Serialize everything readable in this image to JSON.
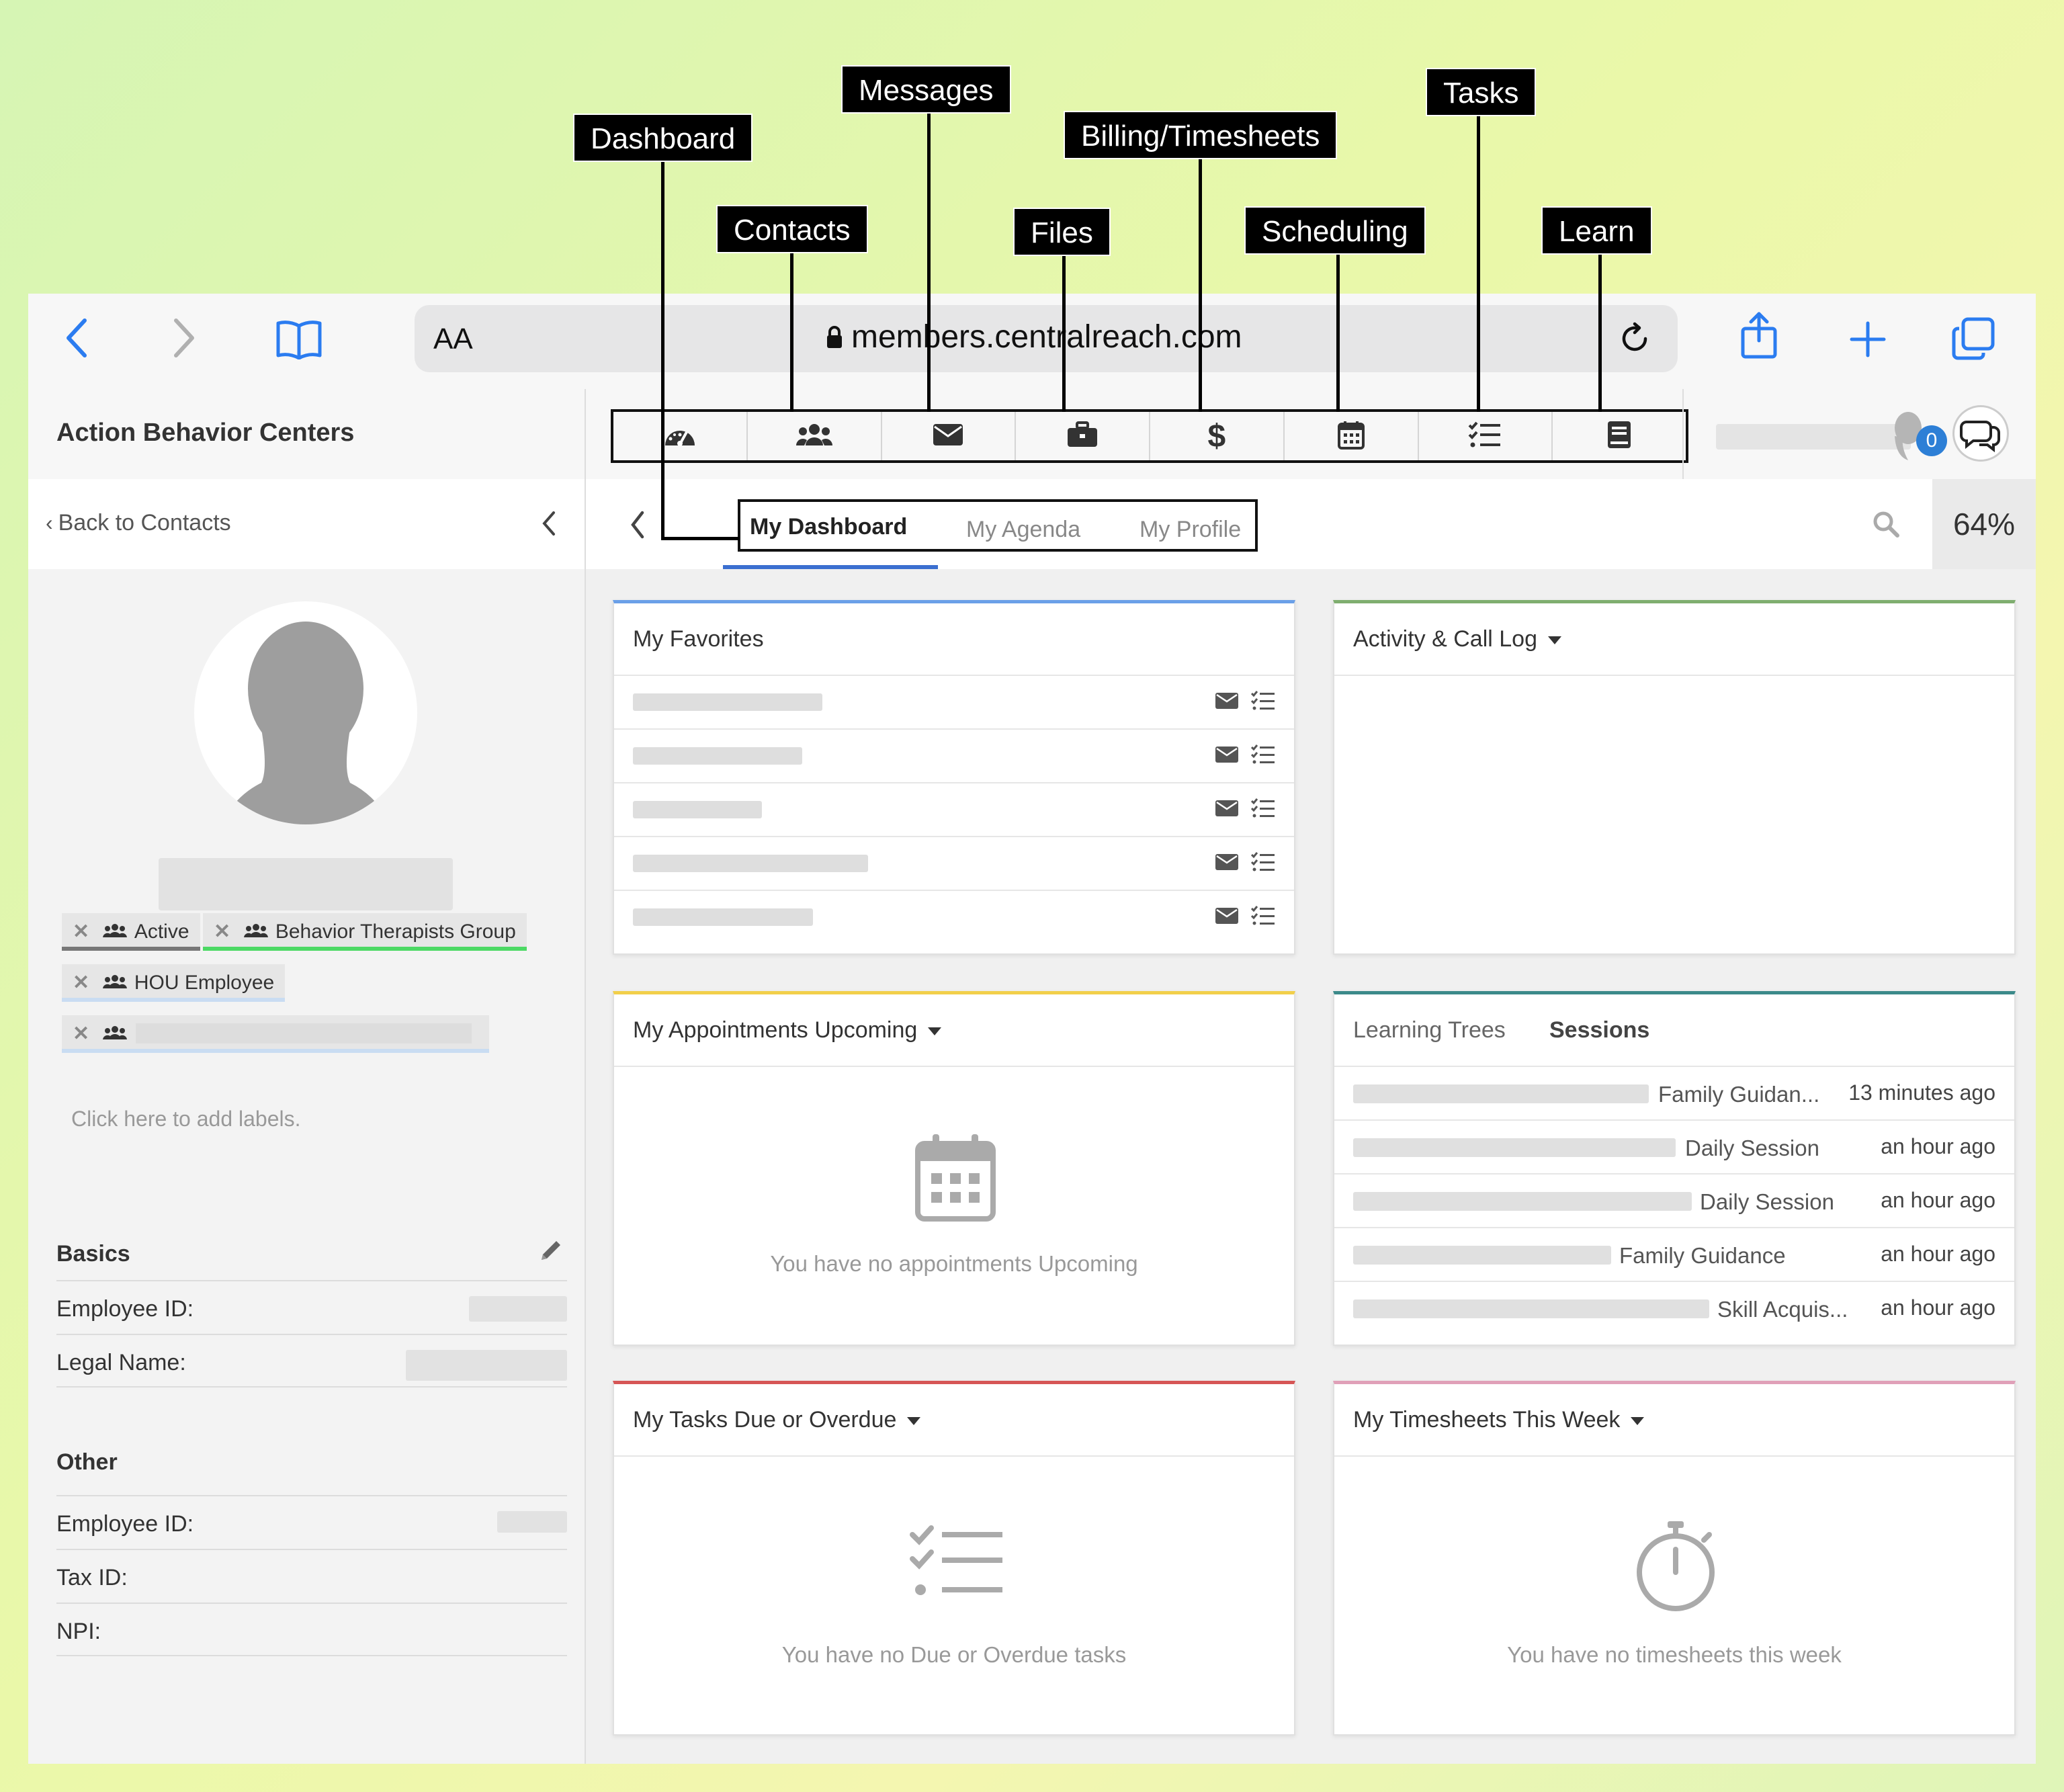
{
  "callouts": {
    "dashboard": "Dashboard",
    "contacts": "Contacts",
    "messages": "Messages",
    "files": "Files",
    "billing": "Billing/Timesheets",
    "scheduling": "Scheduling",
    "tasks": "Tasks",
    "learn": "Learn"
  },
  "browser": {
    "text_size_label": "AA",
    "url": "members.centralreach.com"
  },
  "header": {
    "org_name": "Action Behavior Centers",
    "nav_icons": [
      "dashboard-icon",
      "contacts-icon",
      "messages-icon",
      "files-icon",
      "billing-icon",
      "scheduling-icon",
      "tasks-icon",
      "learn-icon"
    ],
    "notification_count": "0"
  },
  "subheader": {
    "back_label": "Back to Contacts",
    "tabs": [
      "My Dashboard",
      "My Agenda",
      "My Profile"
    ],
    "active_tab": "My Dashboard",
    "zoom": "64%"
  },
  "sidebar": {
    "labels": [
      "Active",
      "Behavior Therapists Group",
      "HOU Employee"
    ],
    "add_labels": "Click here to add labels.",
    "basics": {
      "title": "Basics",
      "fields": [
        "Employee ID:",
        "Legal Name:"
      ]
    },
    "other": {
      "title": "Other",
      "fields": [
        "Employee ID:",
        "Tax ID:",
        "NPI:"
      ]
    }
  },
  "widgets": {
    "favorites": {
      "title": "My Favorites"
    },
    "activity": {
      "title": "Activity & Call Log"
    },
    "appointments": {
      "title": "My Appointments Upcoming",
      "empty": "You have no appointments Upcoming"
    },
    "sessions": {
      "tabs": [
        "Learning Trees",
        "Sessions"
      ],
      "rows": [
        {
          "type": "Family Guidan...",
          "time": "13 minutes ago"
        },
        {
          "type": "Daily Session",
          "time": "an hour ago"
        },
        {
          "type": "Daily Session",
          "time": "an hour ago"
        },
        {
          "type": "Family Guidance",
          "time": "an hour ago"
        },
        {
          "type": "Skill Acquis...",
          "time": "an hour ago"
        }
      ]
    },
    "tasks": {
      "title": "My Tasks Due or Overdue",
      "empty": "You have no Due or Overdue tasks"
    },
    "timesheets": {
      "title": "My Timesheets This Week",
      "empty": "You have no timesheets this week"
    }
  },
  "colors": {
    "accent_blue": "#2b7cf0",
    "favorites_border": "#6aa0e8",
    "activity_border": "#7fae6f",
    "appointments_border": "#f2cf4a",
    "sessions_border": "#3c8a8a",
    "tasks_border": "#d65555",
    "timesheets_border": "#e0a0b8",
    "label_active_underline": "#777777",
    "label_group_underline": "#4cd964",
    "label_hou_underline": "#c9dcf2"
  }
}
